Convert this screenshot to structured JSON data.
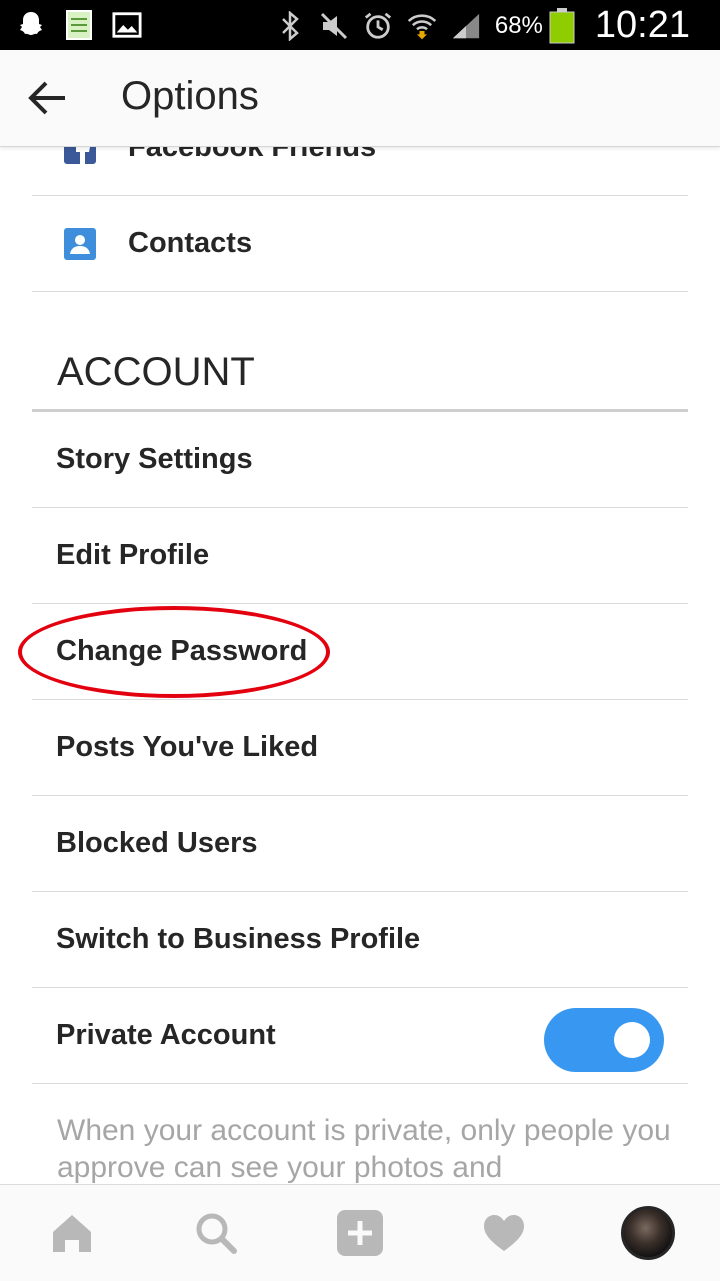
{
  "status_bar": {
    "battery": "68%",
    "time": "10:21",
    "icons": [
      "snapchat-icon",
      "notes-icon",
      "gallery-icon",
      "bluetooth-icon",
      "mute-icon",
      "alarm-icon",
      "wifi-icon",
      "signal-icon",
      "battery-icon"
    ]
  },
  "header": {
    "title": "Options",
    "back_icon": "arrow-left-icon"
  },
  "find_people": [
    {
      "label": "Facebook Friends",
      "icon": "facebook-icon"
    },
    {
      "label": "Contacts",
      "icon": "contacts-icon"
    }
  ],
  "account": {
    "section_title": "ACCOUNT",
    "items": [
      {
        "label": "Story Settings"
      },
      {
        "label": "Edit Profile"
      },
      {
        "label": "Change Password"
      },
      {
        "label": "Posts You've Liked"
      },
      {
        "label": "Blocked Users"
      },
      {
        "label": "Switch to Business Profile"
      },
      {
        "label": "Private Account",
        "toggle_on": true
      }
    ],
    "private_help": "When your account is private, only people you approve can see your photos and"
  },
  "bottom_nav": [
    "home-icon",
    "search-icon",
    "add-post-icon",
    "heart-icon",
    "profile-avatar"
  ],
  "colors": {
    "accent": "#3897f0",
    "highlight": "#e3000f",
    "facebook": "#3b5998",
    "contacts": "#3f8edb"
  }
}
